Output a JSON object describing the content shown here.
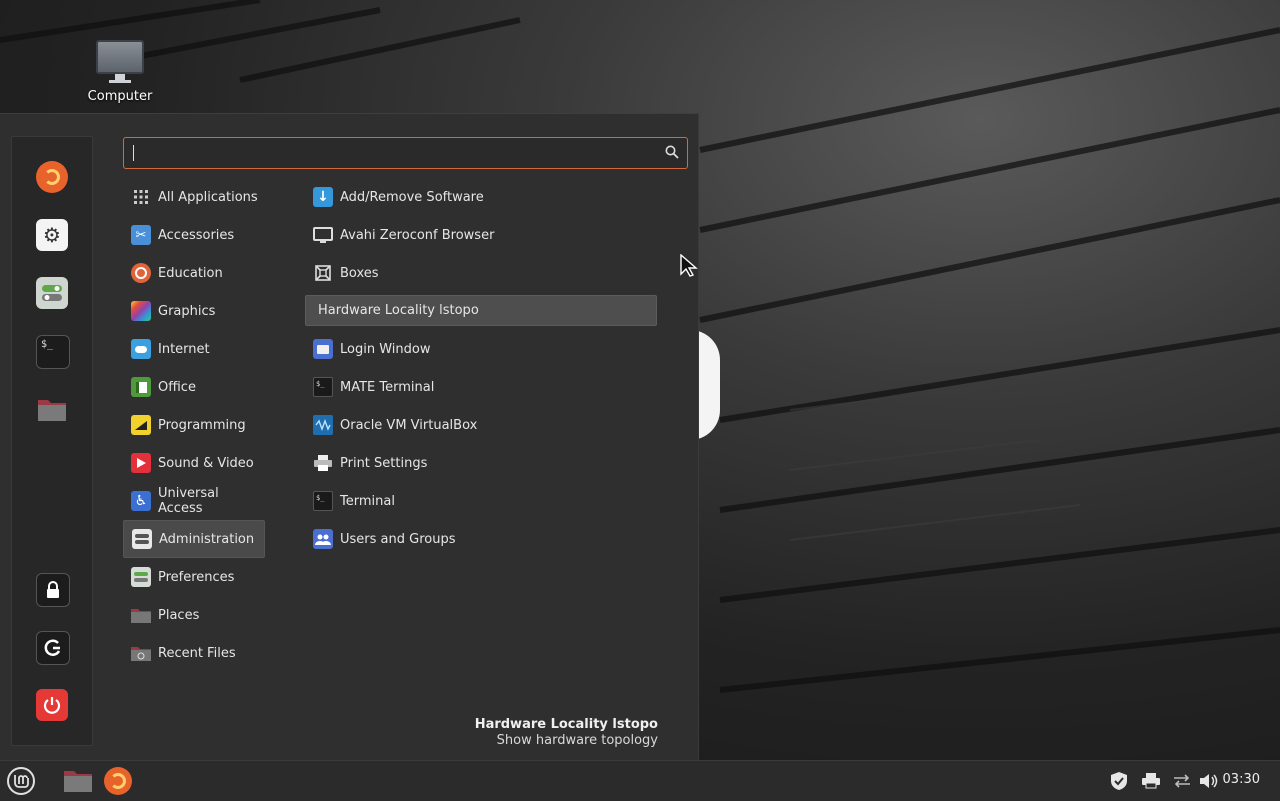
{
  "desktop": {
    "icon_label": "Computer"
  },
  "search": {
    "value": "",
    "placeholder": ""
  },
  "categories": [
    {
      "label": "All Applications",
      "icon": "grid-icon"
    },
    {
      "label": "Accessories",
      "icon": "scissors-icon"
    },
    {
      "label": "Education",
      "icon": "education-icon"
    },
    {
      "label": "Graphics",
      "icon": "graphics-icon"
    },
    {
      "label": "Internet",
      "icon": "cloud-icon"
    },
    {
      "label": "Office",
      "icon": "office-icon"
    },
    {
      "label": "Programming",
      "icon": "programming-icon"
    },
    {
      "label": "Sound & Video",
      "icon": "play-icon"
    },
    {
      "label": "Universal Access",
      "icon": "accessibility-icon"
    },
    {
      "label": "Administration",
      "icon": "administration-icon",
      "active": true
    },
    {
      "label": "Preferences",
      "icon": "preferences-icon"
    },
    {
      "label": "Places",
      "icon": "folder-icon"
    },
    {
      "label": "Recent Files",
      "icon": "recent-files-icon"
    }
  ],
  "apps": [
    {
      "label": "Add/Remove Software",
      "icon": "download-icon"
    },
    {
      "label": "Avahi Zeroconf Browser",
      "icon": "monitor-icon"
    },
    {
      "label": "Boxes",
      "icon": "boxes-icon"
    },
    {
      "label": "Hardware Locality lstopo",
      "icon": "",
      "hover": true
    },
    {
      "label": "Login Window",
      "icon": "login-icon"
    },
    {
      "label": "MATE Terminal",
      "icon": "terminal-icon"
    },
    {
      "label": "Oracle VM VirtualBox",
      "icon": "virtualbox-icon"
    },
    {
      "label": "Print Settings",
      "icon": "printer-icon"
    },
    {
      "label": "Terminal",
      "icon": "terminal-icon"
    },
    {
      "label": "Users and Groups",
      "icon": "users-icon"
    }
  ],
  "description": {
    "title": "Hardware Locality lstopo",
    "text": "Show hardware topology"
  },
  "taskbar": {
    "clock": "03:30"
  },
  "colors": {
    "accent": "#d4693b",
    "firefox": "#e8622c",
    "power": "#e53935"
  }
}
